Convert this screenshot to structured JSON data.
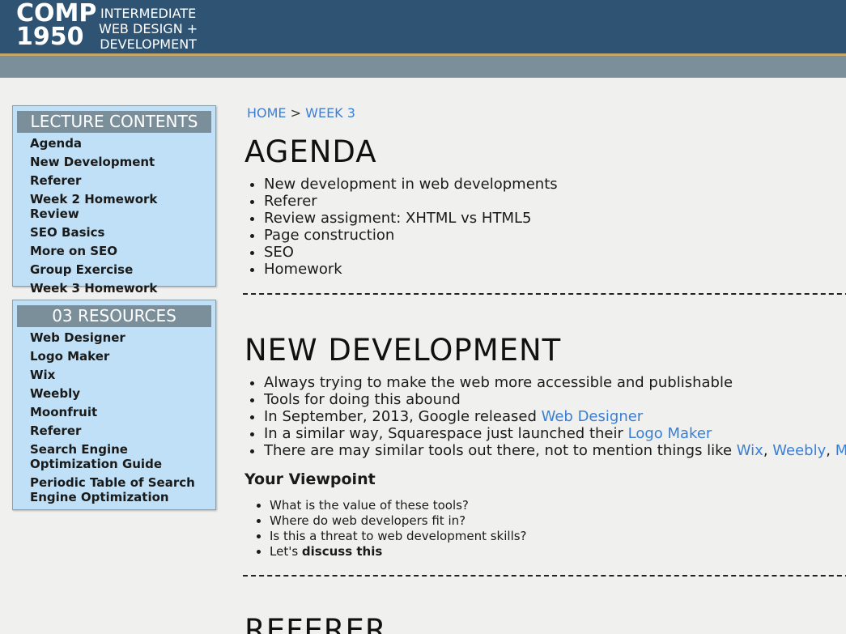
{
  "header": {
    "course_code_line1": "COMP",
    "course_code_line2": "1950",
    "course_name_line1": "INTERMEDIATE",
    "course_name_line2": "WEB DESIGN +",
    "course_name_line3": "DEVELOPMENT"
  },
  "sidebar": {
    "lecture": {
      "title": "LECTURE CONTENTS",
      "items": [
        "Agenda",
        "New Development",
        "Referer",
        "Week 2 Homework Review",
        "SEO Basics",
        "More on SEO",
        "Group Exercise",
        "Week 3 Homework"
      ]
    },
    "resources": {
      "title": "03 RESOURCES",
      "items": [
        "Web Designer",
        "Logo Maker",
        "Wix",
        "Weebly",
        "Moonfruit",
        "Referer",
        "Search Engine Optimization Guide",
        "Periodic Table of Search Engine Optimization"
      ]
    }
  },
  "breadcrumb": {
    "home": "HOME",
    "separator": ">",
    "current": "WEEK 3"
  },
  "agenda": {
    "title": "AGENDA",
    "items": [
      "New development in web developments",
      "Referer",
      "Review assigment: XHTML vs HTML5",
      "Page construction",
      "SEO",
      "Homework"
    ]
  },
  "new_development": {
    "title": "NEW DEVELOPMENT",
    "item1": "Always trying to make the web more accessible and publishable",
    "item2": "Tools for doing this abound",
    "item3_prefix": "In September, 2013, Google released ",
    "item3_link": "Web Designer",
    "item4_prefix": "In a similar way, Squarespace just launched their ",
    "item4_link": "Logo Maker",
    "item5_prefix": "There are may similar tools out there, not to mention things like ",
    "item5_link1": "Wix",
    "item5_sep1": ", ",
    "item5_link2": "Weebly",
    "item5_sep2": ", ",
    "item5_link3": "Mo",
    "viewpoint_title": "Your Viewpoint",
    "viewpoint_items": [
      "What is the value of these tools?",
      "Where do web developers fit in?",
      "Is this a threat to web development skills?"
    ],
    "viewpoint_last_prefix": "Let's ",
    "viewpoint_last_bold": "discuss this"
  },
  "referer": {
    "title": "REFERER"
  },
  "colors": {
    "header": "#2f5473",
    "accent_gold": "#c4a768",
    "subbar": "#7b8f9b",
    "sidebox": "#bfe0f6",
    "link": "#3b7fd4"
  }
}
